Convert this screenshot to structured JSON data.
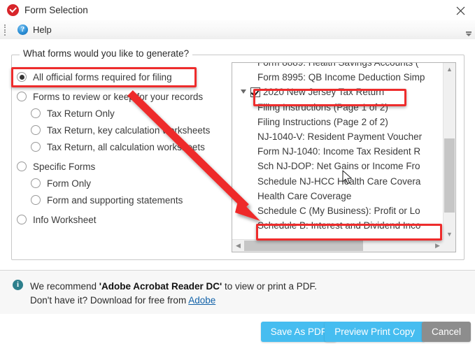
{
  "window": {
    "title": "Form Selection",
    "app_icon": "checkmark-circle-icon",
    "close_icon": "close-icon"
  },
  "toolbar": {
    "grip_icon": "drag-grip-icon",
    "help_icon": "question-mark-icon",
    "help_label": "Help",
    "overflow_icon": "toolbar-overflow-icon"
  },
  "group": {
    "legend": "What forms would you like to generate?"
  },
  "radio_options": [
    {
      "label": "All official forms required for filing",
      "checked": true,
      "indent": false,
      "highlighted": true
    },
    {
      "label": "Forms to review or keep for your records",
      "checked": false,
      "indent": false,
      "highlighted": false
    },
    {
      "label": "Tax Return Only",
      "checked": false,
      "indent": true,
      "highlighted": false
    },
    {
      "label": "Tax Return, key calculation worksheets",
      "checked": false,
      "indent": true,
      "highlighted": false
    },
    {
      "label": "Tax Return, all calculation worksheets",
      "checked": false,
      "indent": true,
      "highlighted": false
    },
    {
      "label": "Specific Forms",
      "checked": false,
      "indent": false,
      "highlighted": false
    },
    {
      "label": "Form Only",
      "checked": false,
      "indent": true,
      "highlighted": false
    },
    {
      "label": "Form and supporting statements",
      "checked": false,
      "indent": true,
      "highlighted": false
    },
    {
      "label": "Info Worksheet",
      "checked": false,
      "indent": false,
      "highlighted": false
    }
  ],
  "forms_list": {
    "rows": [
      {
        "label": "Form 8889: Health Savings Accounts (",
        "type": "child",
        "checkbox": null,
        "toggle": null,
        "clipped": true
      },
      {
        "label": "Form 8995: QB Income Deduction Simp",
        "type": "child",
        "checkbox": null,
        "toggle": null,
        "clipped": false
      },
      {
        "label": "2020 New Jersey Tax Return",
        "type": "parent",
        "checkbox": true,
        "toggle": "open",
        "clipped": false
      },
      {
        "label": "Filing Instructions (Page 1 of 2)",
        "type": "child",
        "checkbox": null,
        "toggle": null,
        "clipped": false
      },
      {
        "label": "Filing Instructions (Page 2 of 2)",
        "type": "child",
        "checkbox": null,
        "toggle": null,
        "clipped": false
      },
      {
        "label": "NJ-1040-V: Resident Payment Voucher",
        "type": "child",
        "checkbox": null,
        "toggle": null,
        "clipped": false
      },
      {
        "label": "Form NJ-1040: Income Tax Resident R",
        "type": "child",
        "checkbox": null,
        "toggle": null,
        "clipped": false
      },
      {
        "label": "Sch NJ-DOP: Net Gains or Income Fro",
        "type": "child",
        "checkbox": null,
        "toggle": null,
        "clipped": false
      },
      {
        "label": "Schedule NJ-HCC Health Care Covera",
        "type": "child",
        "checkbox": null,
        "toggle": null,
        "clipped": false
      },
      {
        "label": "Health Care Coverage",
        "type": "child",
        "checkbox": null,
        "toggle": null,
        "clipped": false
      },
      {
        "label": "Schedule C (My Business): Profit or Lo",
        "type": "child",
        "checkbox": null,
        "toggle": null,
        "clipped": false
      },
      {
        "label": "Schedule B: Interest and Dividend Inco",
        "type": "child",
        "checkbox": null,
        "toggle": null,
        "clipped": false
      }
    ],
    "vertical_scrollbar": {
      "up_icon": "chevron-up-icon",
      "down_icon": "chevron-down-icon"
    },
    "horizontal_scrollbar": {
      "left_icon": "chevron-left-icon",
      "right_icon": "chevron-right-icon"
    }
  },
  "annotations": {
    "highlight_radio": "All official forms required for filing",
    "highlight_list_item_1": "2020 New Jersey Tax Return",
    "highlight_list_item_2": "Schedule B: Interest and Dividend Inco",
    "arrow_color": "#ee2c2c",
    "box_color": "#ee2c2c"
  },
  "recommendation": {
    "icon": "info-icon",
    "line1_prefix": "We recommend ",
    "line1_bold": "'Adobe Acrobat Reader DC'",
    "line1_suffix": " to view or print a PDF.",
    "line2_prefix": "Don't have it? Download for free from ",
    "line2_link": "Adobe"
  },
  "buttons": {
    "save_as_pdf": "Save As PDF",
    "preview_print_copy": "Preview Print Copy",
    "cancel": "Cancel",
    "primary_color": "#46bdf0",
    "secondary_color": "#8d8d8d"
  }
}
